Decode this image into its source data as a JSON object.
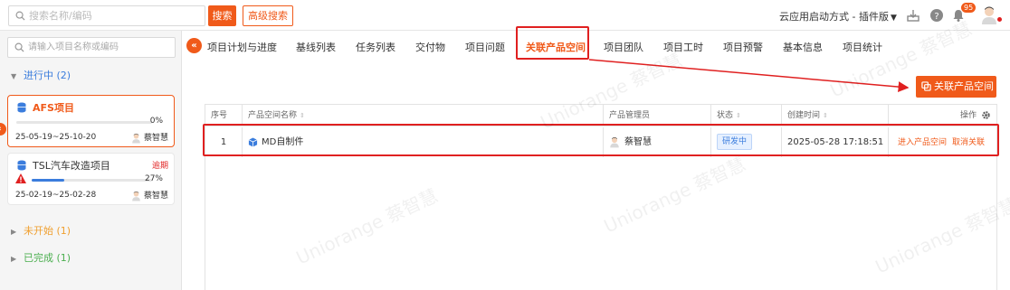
{
  "topbar": {
    "search_placeholder": "搜索名称/编码",
    "search_button": "搜索",
    "advanced_search_button": "高级搜索",
    "launch_mode": "云应用启动方式 - 插件版",
    "notification_count": "95"
  },
  "sidebar": {
    "search_placeholder": "请输入项目名称或编码",
    "groups": {
      "active": "进行中 (2)",
      "not_started": "未开始 (1)",
      "done": "已完成 (1)"
    },
    "projects": [
      {
        "name": "AFS项目",
        "progress": "0%",
        "progress_value": 0,
        "dates": "25-05-19~25-10-20",
        "owner": "蔡智慧",
        "overdue": ""
      },
      {
        "name": "TSL汽车改造项目",
        "progress": "27%",
        "progress_value": 27,
        "dates": "25-02-19~25-02-28",
        "owner": "蔡智慧",
        "overdue": "逾期"
      }
    ]
  },
  "tabs": [
    "项目计划与进度",
    "基线列表",
    "任务列表",
    "交付物",
    "项目问题",
    "关联产品空间",
    "项目团队",
    "项目工时",
    "项目预警",
    "基本信息",
    "项目统计"
  ],
  "active_tab": "关联产品空间",
  "main": {
    "link_button": "关联产品空间",
    "table": {
      "headers": {
        "index": "序号",
        "name": "产品空间名称",
        "manager": "产品管理员",
        "status": "状态",
        "created": "创建时间",
        "actions": "操作"
      },
      "rows": [
        {
          "index": "1",
          "name": "MD自制件",
          "manager": "蔡智慧",
          "status": "研发中",
          "created": "2025-05-28 17:18:51",
          "action_enter": "进入产品空间",
          "action_unlink": "取消关联"
        }
      ]
    }
  },
  "watermark": "Uniorange 蔡智慧",
  "colors": {
    "accent": "#f05a1a",
    "highlight": "#e02020",
    "active_group": "#3b7ddd",
    "not_started_group": "#f0a030",
    "done_group": "#4caf50"
  }
}
